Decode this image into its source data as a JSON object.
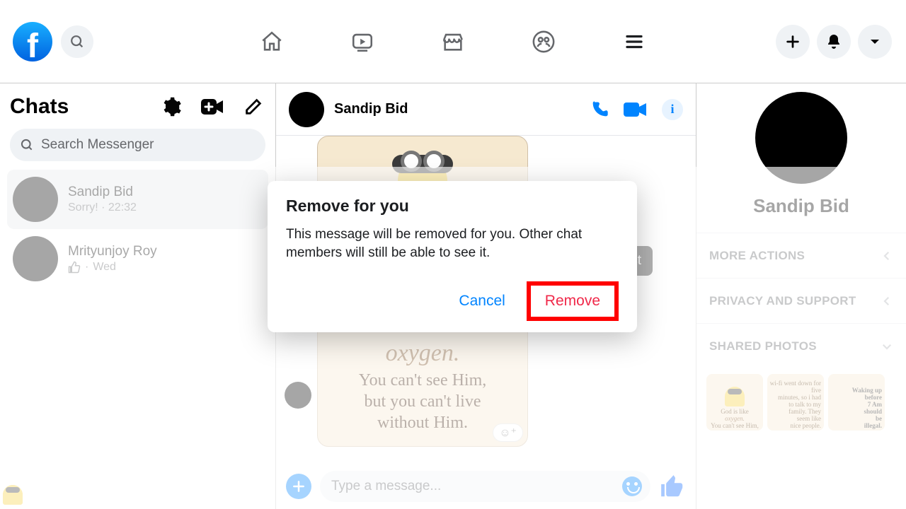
{
  "topnav": {
    "icons": [
      "home-icon",
      "watch-icon",
      "marketplace-icon",
      "groups-icon",
      "menu-icon"
    ],
    "right": [
      "create-icon",
      "notifications-icon",
      "account-icon"
    ]
  },
  "sidebar": {
    "title": "Chats",
    "search_placeholder": "Search Messenger",
    "items": [
      {
        "name": "Sandip Bid",
        "preview": "Sorry! · 22:32",
        "active": true
      },
      {
        "name": "Mrityunjoy Roy",
        "preview_time": "Wed",
        "liked": true,
        "active": false
      }
    ]
  },
  "chat": {
    "title": "Sandip Bid",
    "react_tooltip": "React",
    "message_image": {
      "word_oxygen": "oxygen.",
      "line1": "You can't see Him,",
      "line2": "but you can't live",
      "line3": "without Him."
    },
    "composer_placeholder": "Type a message..."
  },
  "details": {
    "name": "Sandip Bid",
    "rows": [
      "MORE ACTIONS",
      "PRIVACY AND SUPPORT",
      "SHARED PHOTOS"
    ],
    "photos": [
      {
        "caption1": "God is like",
        "caption2": "oxygen.",
        "caption3": "You can't see Him,"
      },
      {
        "line1": "wi-fi went down for five",
        "line2": "minutes, so i had",
        "line3": "to talk to my",
        "line4": "family. They",
        "line5": "seem like",
        "line6": "nice people."
      },
      {
        "line1": "Waking up",
        "line2": "before",
        "line3": "7 Am",
        "line4": "should",
        "line5": "be",
        "line6": "illegal."
      }
    ]
  },
  "modal": {
    "title": "Remove for you",
    "body": "This message will be removed for you. Other chat members will still be able to see it.",
    "cancel": "Cancel",
    "remove": "Remove"
  }
}
